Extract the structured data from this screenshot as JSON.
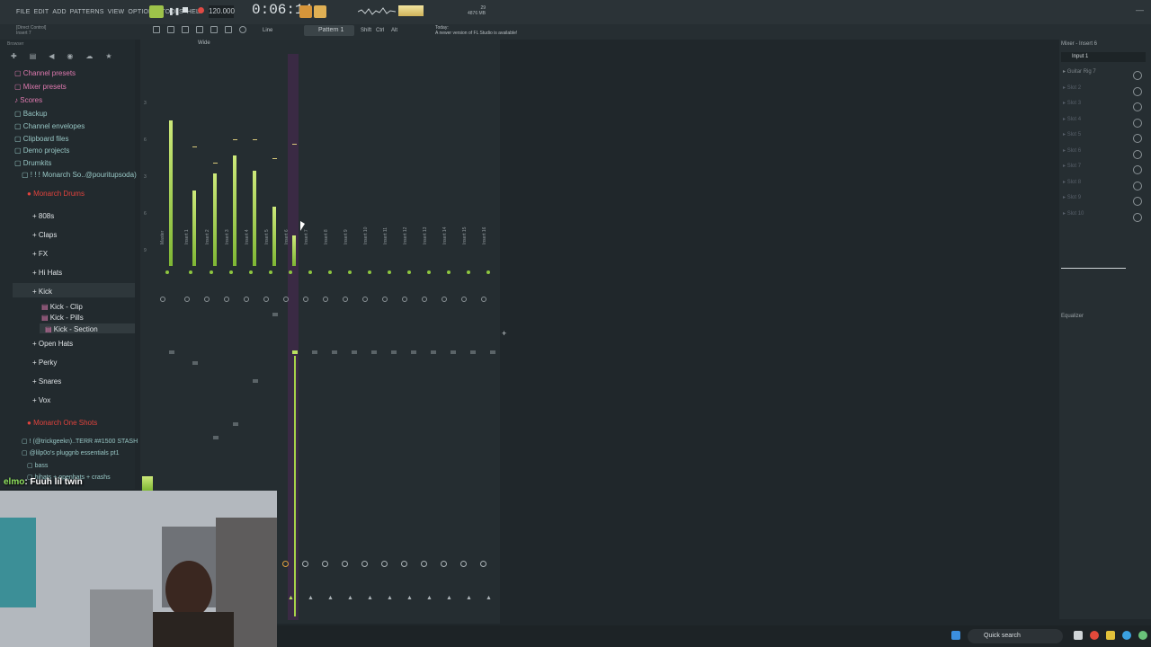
{
  "menubar": {
    "items": [
      "FILE",
      "EDIT",
      "ADD",
      "PATTERNS",
      "VIEW",
      "OPTIONS",
      "TOOLS",
      "HELP"
    ],
    "tempo": "120.000",
    "time": "0:06:14",
    "memory": "29",
    "memory_label": "4876 MB"
  },
  "toolbar": {
    "insert_hint": "[Direct Control]",
    "insert_name": "Insert 7",
    "pattern": "Pattern 1",
    "snap": "Line",
    "shift": "Shift",
    "ctrl": "Ctrl",
    "alt": "Alt",
    "news_title": "Today:",
    "news_text": "A newer version of FL Studio is available!"
  },
  "browser": {
    "header": "Browser",
    "items": [
      {
        "label": "Channel presets"
      },
      {
        "label": "Mixer presets"
      },
      {
        "label": "Scores"
      },
      {
        "label": "Backup"
      },
      {
        "label": "Channel envelopes"
      },
      {
        "label": "Clipboard files"
      },
      {
        "label": "Demo projects"
      },
      {
        "label": "Drumkits"
      },
      {
        "label": "! ! ! Monarch So..@pouritupsoda)"
      },
      {
        "label": "Monarch Drums"
      },
      {
        "label": "808s"
      },
      {
        "label": "Claps"
      },
      {
        "label": "FX"
      },
      {
        "label": "Hi Hats"
      },
      {
        "label": "Kick"
      },
      {
        "label": "Kick - Clip"
      },
      {
        "label": "Kick - Pills"
      },
      {
        "label": "Kick - Section"
      },
      {
        "label": "Open Hats"
      },
      {
        "label": "Perky"
      },
      {
        "label": "Snares"
      },
      {
        "label": "Vox"
      },
      {
        "label": "Monarch One Shots"
      },
      {
        "label": "! (@trickgeekn)..TERR ##1500 STASH"
      },
      {
        "label": "@lilp0o's pluggnb essentials pt1"
      },
      {
        "label": "bass"
      },
      {
        "label": "hihats + openhats + crashs"
      }
    ]
  },
  "mixer": {
    "wide": "Wide",
    "tracks": [
      "Master",
      "Insert 1",
      "Insert 2",
      "Insert 3",
      "Insert 4",
      "Insert 5",
      "Insert 6",
      "Insert 7",
      "Insert 8",
      "Insert 9",
      "Insert 10",
      "Insert 11",
      "Insert 12",
      "Insert 13",
      "Insert 14",
      "Insert 15",
      "Insert 16"
    ],
    "scale": [
      "3",
      "6",
      "3",
      "6",
      "9",
      "12",
      "15",
      "18",
      "21",
      "24",
      "27",
      "30",
      "33"
    ]
  },
  "fx_panel": {
    "title": "Mixer - Insert 6",
    "input": "Input 1",
    "slots": [
      "Guitar Rig 7",
      "Slot 2",
      "Slot 3",
      "Slot 4",
      "Slot 5",
      "Slot 6",
      "Slot 7",
      "Slot 8",
      "Slot 9",
      "Slot 10"
    ],
    "eq_label": "Equalizer"
  },
  "chat": {
    "name": "elmo",
    "message": ": Fuuh lil twin"
  },
  "taskbar": {
    "search": "Quick search"
  },
  "colors": {
    "accent_green": "#9ec34a",
    "selected_strip": "#3a2a44",
    "browser_folder": "#97c6c4",
    "browser_pink": "#e07ab0",
    "browser_red": "#e2433d"
  }
}
